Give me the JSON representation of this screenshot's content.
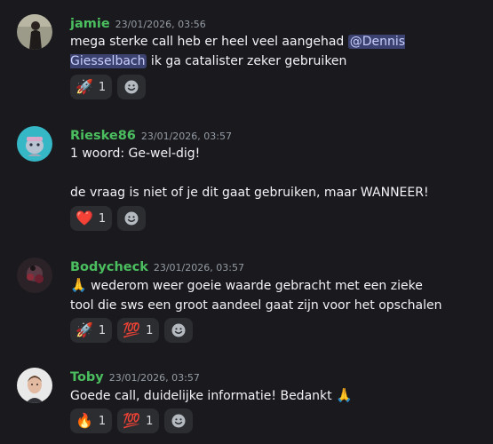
{
  "messages": [
    {
      "author": "jamie",
      "timestamp": "23/01/2026, 03:56",
      "text_before": "mega sterke call heb er heel veel aangehad ",
      "mention": "@Dennis Giesselbach",
      "text_after": " ik ga catalister zeker gebruiken",
      "reactions": [
        {
          "emoji": "🚀",
          "count": "1"
        }
      ]
    },
    {
      "author": "Rieske86",
      "timestamp": "23/01/2026, 03:57",
      "line1": "1 woord: Ge-wel-dig!",
      "line2": "de vraag is niet of je dit gaat gebruiken, maar WANNEER!",
      "reactions": [
        {
          "emoji": "❤️",
          "count": "1"
        }
      ]
    },
    {
      "author": "Bodycheck",
      "timestamp": "23/01/2026, 03:57",
      "emoji_lead": "🙏",
      "text": " wederom weer goeie waarde gebracht met een zieke tool die sws een groot aandeel gaat zijn voor het opschalen",
      "reactions": [
        {
          "emoji": "🚀",
          "count": "1"
        },
        {
          "emoji": "💯",
          "count": "1"
        }
      ]
    },
    {
      "author": "Toby",
      "timestamp": "23/01/2026, 03:57",
      "text": "Goede call, duidelijke informatie! Bedankt ",
      "emoji_trail": "🙏",
      "reactions": [
        {
          "emoji": "🔥",
          "count": "1"
        },
        {
          "emoji": "💯",
          "count": "1"
        }
      ]
    }
  ],
  "colors": {
    "author": "#4bbf5f",
    "mention_bg": "#3c4270",
    "reaction_bg": "#2b2d31"
  }
}
